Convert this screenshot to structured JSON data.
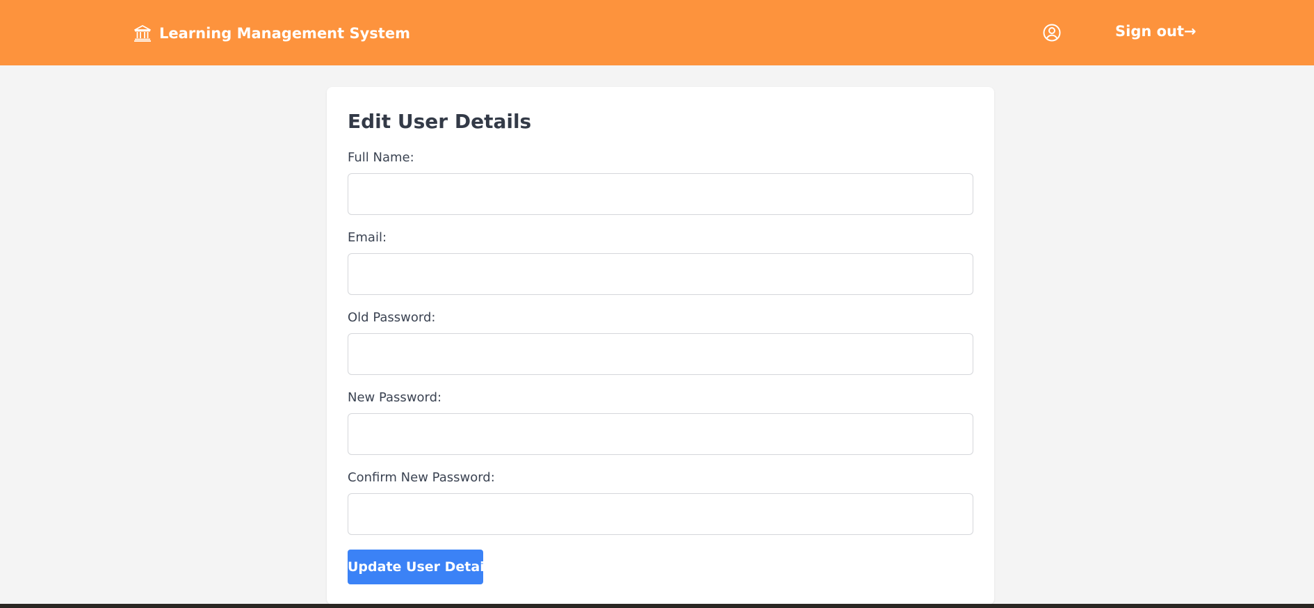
{
  "header": {
    "title": "Learning Management System",
    "brand_icon": "bank-building-icon",
    "user_icon": "user-circle-icon",
    "signout_label": "Sign out→"
  },
  "form": {
    "title": "Edit User Details",
    "fields": [
      {
        "label": "Full Name:",
        "value": "",
        "type": "text"
      },
      {
        "label": "Email:",
        "value": "",
        "type": "email"
      },
      {
        "label": "Old Password:",
        "value": "",
        "type": "password"
      },
      {
        "label": "New Password:",
        "value": "",
        "type": "password"
      },
      {
        "label": "Confirm New Password:",
        "value": "",
        "type": "password"
      }
    ],
    "submit_label": "Update User Details"
  },
  "colors": {
    "header_bg": "#fd933d",
    "page_bg": "#f4f4f4",
    "primary_button": "#3b82f6",
    "heading_text": "#333a47"
  }
}
